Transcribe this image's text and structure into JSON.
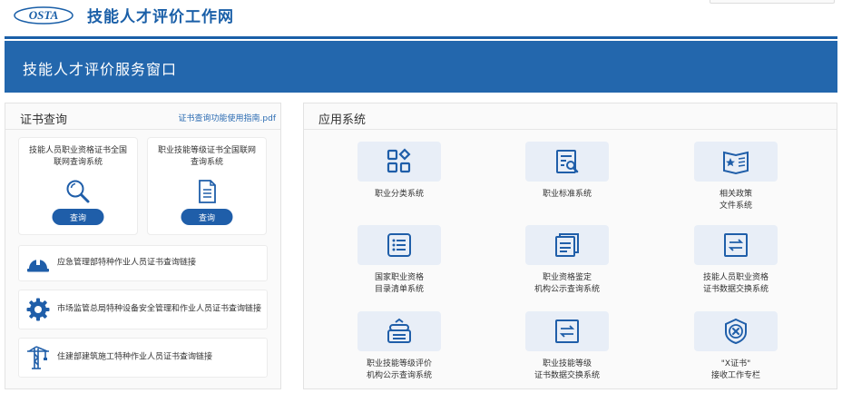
{
  "header": {
    "logo_text": "OSTA",
    "site_title": "技能人才评价工作网"
  },
  "banner": {
    "title": "技能人才评价服务窗口"
  },
  "cert_query": {
    "title": "证书查询",
    "guide_link": "证书查询功能使用指南.pdf",
    "cards": [
      {
        "label": "技能人员职业资格证书全国联网查询系统",
        "icon": "magnifier-icon",
        "button": "查询"
      },
      {
        "label": "职业技能等级证书全国联网查询系统",
        "icon": "document-icon",
        "button": "查询"
      }
    ],
    "links": [
      {
        "label": "应急管理部特种作业人员证书查询链接",
        "icon": "safety-helmet-icon"
      },
      {
        "label": "市场监管总局特种设备安全管理和作业人员证书查询链接",
        "icon": "gear-icon"
      },
      {
        "label": "住建部建筑施工特种作业人员证书查询链接",
        "icon": "tower-crane-icon"
      }
    ]
  },
  "apps": {
    "title": "应用系统",
    "items": [
      {
        "label": "职业分类系统",
        "icon": "category-grid-icon"
      },
      {
        "label": "职业标准系统",
        "icon": "standard-search-icon"
      },
      {
        "label": "相关政策\n文件系统",
        "icon": "policy-book-icon"
      },
      {
        "label": "国家职业资格\n目录清单系统",
        "icon": "list-icon"
      },
      {
        "label": "职业资格鉴定\n机构公示查询系统",
        "icon": "stacked-docs-icon"
      },
      {
        "label": "技能人员职业资格\n证书数据交换系统",
        "icon": "exchange-icon"
      },
      {
        "label": "职业技能等级评价\n机构公示查询系统",
        "icon": "institution-icon"
      },
      {
        "label": "职业技能等级\n证书数据交换系统",
        "icon": "exchange-icon"
      },
      {
        "label": "\"X证书\"\n接收工作专栏",
        "icon": "x-badge-icon"
      }
    ]
  },
  "colors": {
    "brand_blue": "#1a5fa8",
    "banner_blue": "#2367ad",
    "button_blue": "#1f5ea9",
    "tile_bg": "#e8eef7"
  }
}
